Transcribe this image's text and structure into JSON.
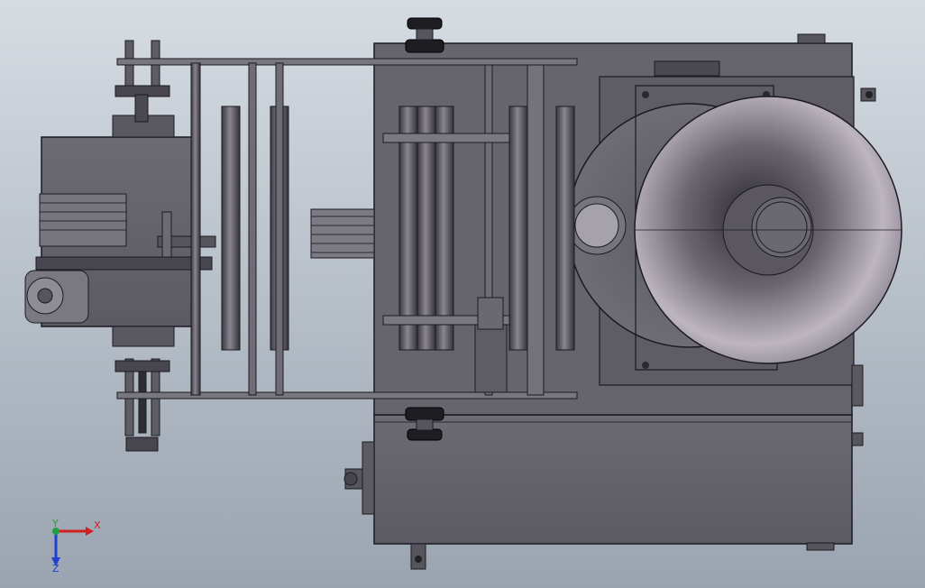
{
  "scene": {
    "type": "cad-model-top-view",
    "background_colors": [
      "#d6dce2",
      "#9aa4b0"
    ],
    "body_color": "#6a6870",
    "edge_color": "#1c1b20"
  },
  "triad": {
    "x_label": "X",
    "y_label": "Y",
    "z_label": "Z",
    "x_color": "#d02020",
    "y_color": "#20a040",
    "z_color": "#2040d0"
  }
}
